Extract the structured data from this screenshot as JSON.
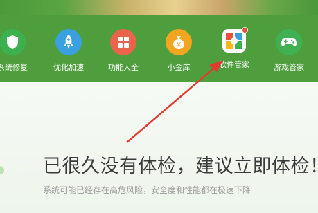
{
  "toolbar": {
    "items": [
      {
        "label": "系统修复",
        "icon": "shield-icon",
        "color": "#3db04f"
      },
      {
        "label": "优化加速",
        "icon": "rocket-icon",
        "color": "#3aa0e0"
      },
      {
        "label": "功能大全",
        "icon": "grid-icon",
        "color": "#e9644a"
      },
      {
        "label": "小金库",
        "icon": "money-bag-icon",
        "color": "#f2a51f"
      },
      {
        "label": "软件管家",
        "icon": "software-manager-icon",
        "color": "#ffffff"
      },
      {
        "label": "游戏管家",
        "icon": "gamepad-icon",
        "color": "#3fb152"
      }
    ]
  },
  "main": {
    "headline": "已很久没有体检，建议立即体检！",
    "subline": "系统可能已经存在高危风险，安全度和性能都在极速下降"
  },
  "colors": {
    "toolbar_bg": "#4f9e3d",
    "arrow": "#e23b2e"
  }
}
